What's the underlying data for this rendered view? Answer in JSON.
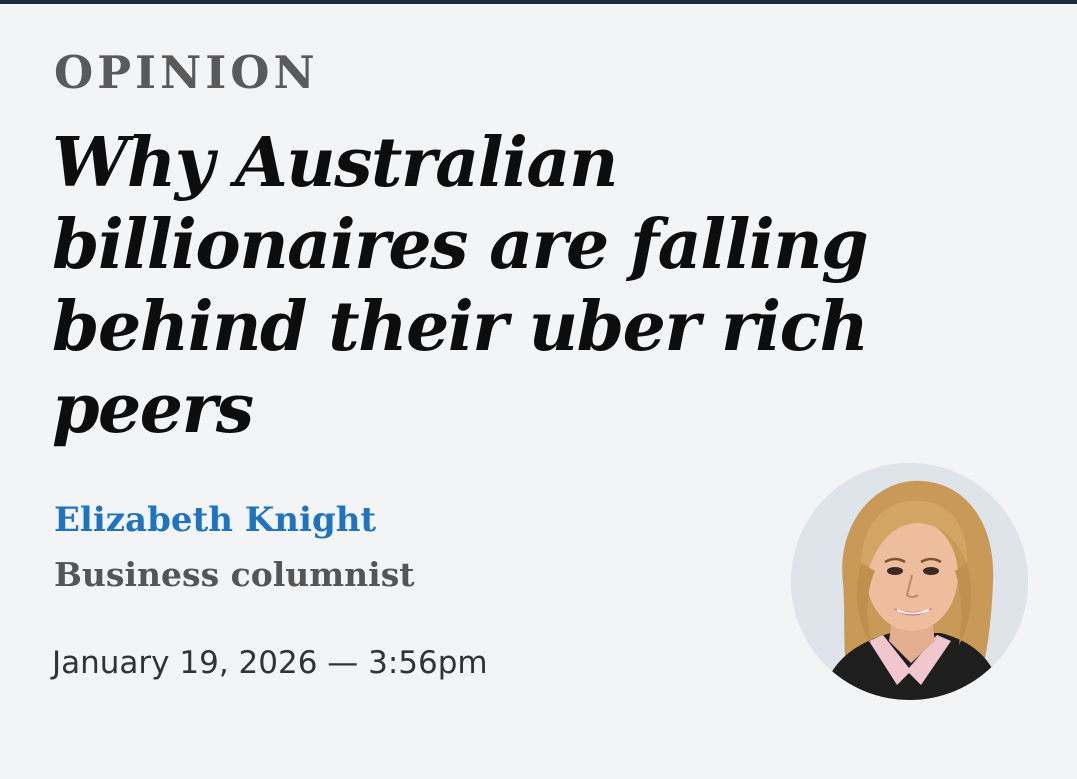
{
  "article": {
    "kicker": "OPINION",
    "headline": "Why Australian billionaires are falling behind their uber rich peers"
  },
  "author": {
    "name": "Elizabeth Knight",
    "role": "Business columnist",
    "avatar_icon": "author-portrait"
  },
  "published": {
    "timestamp": "January 19, 2026 — 3:56pm"
  },
  "colors": {
    "background": "#f3f4f6",
    "top_rule": "#1d2a3a",
    "author_link": "#1f73bf",
    "kicker": "#5a5a5a"
  }
}
